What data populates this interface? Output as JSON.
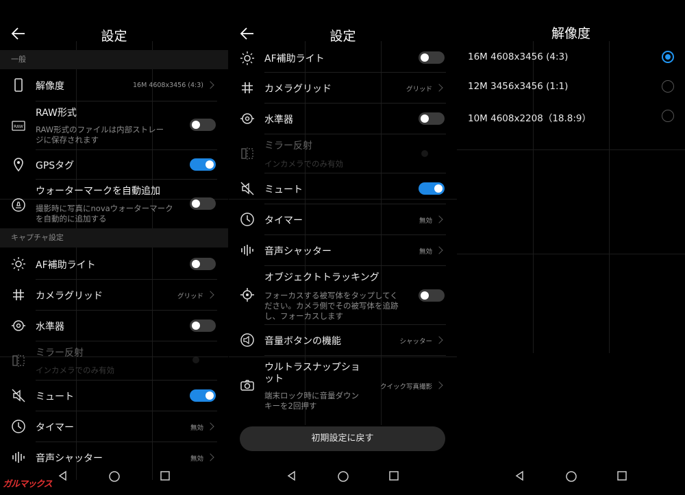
{
  "colors": {
    "accent": "#1e88e5",
    "background": "#000000",
    "section": "#161616",
    "watermark": "#e03030"
  },
  "panel1": {
    "title": "設定",
    "sections": {
      "general": "一般",
      "capture": "キャプチャ設定"
    },
    "resolution": {
      "label": "解像度",
      "value": "16M 4608x3456 (4:3)",
      "icon": "phone-outline-icon"
    },
    "raw": {
      "label": "RAW形式",
      "sub1": "RAW形式のファイルは内部ストレー",
      "sub2": "ジに保存されます",
      "icon": "raw-icon",
      "on": false
    },
    "gps": {
      "label": "GPSタグ",
      "icon": "location-pin-icon",
      "on": true
    },
    "watermark": {
      "label": "ウォーターマークを自動追加",
      "sub1": "撮影時に写真にnovaウォーターマーク",
      "sub2": "を自動的に追加する",
      "icon": "watermark-icon",
      "on": false
    },
    "af": {
      "label": "AF補助ライト",
      "on": false
    },
    "grid": {
      "label": "カメラグリッド",
      "value": "グリッド"
    },
    "level": {
      "label": "水準器",
      "on": false
    },
    "mirror": {
      "label": "ミラー反射",
      "sub": "インカメラでのみ有効"
    },
    "mute": {
      "label": "ミュート",
      "on": true
    },
    "timer": {
      "label": "タイマー",
      "value": "無効"
    },
    "shutter": {
      "label": "音声シャッター",
      "value": "無効"
    }
  },
  "panel2": {
    "title": "設定",
    "af": {
      "label": "AF補助ライト",
      "on": false
    },
    "grid": {
      "label": "カメラグリッド",
      "value": "グリッド"
    },
    "level": {
      "label": "水準器",
      "on": false
    },
    "mirror": {
      "label": "ミラー反射",
      "sub": "インカメラでのみ有効"
    },
    "mute": {
      "label": "ミュート",
      "on": true
    },
    "timer": {
      "label": "タイマー",
      "value": "無効"
    },
    "shutter": {
      "label": "音声シャッター",
      "value": "無効"
    },
    "tracking": {
      "label": "オブジェクトトラッキング",
      "sub1": "フォーカスする被写体をタップしてく",
      "sub2": "ださい。カメラ側でその被写体を追跡",
      "sub3": "し、フォーカスします",
      "on": false
    },
    "volume": {
      "label": "音量ボタンの機能",
      "value": "シャッター"
    },
    "snapshot": {
      "label1": "ウルトラスナップショ",
      "label2": "ット",
      "sub1": "端末ロック時に音量ダウン",
      "sub2": "キーを2回押す",
      "value": "クイック写真撮影"
    },
    "reset": "初期設定に戻す"
  },
  "panel3": {
    "title": "解像度",
    "options": [
      {
        "label": "16M 4608x3456 (4:3)",
        "selected": true
      },
      {
        "label": "12M 3456x3456 (1:1)",
        "selected": false
      },
      {
        "label": "10M 4608x2208（18.8:9）",
        "selected": false
      }
    ]
  },
  "watermark_logo": "ガルマックス"
}
